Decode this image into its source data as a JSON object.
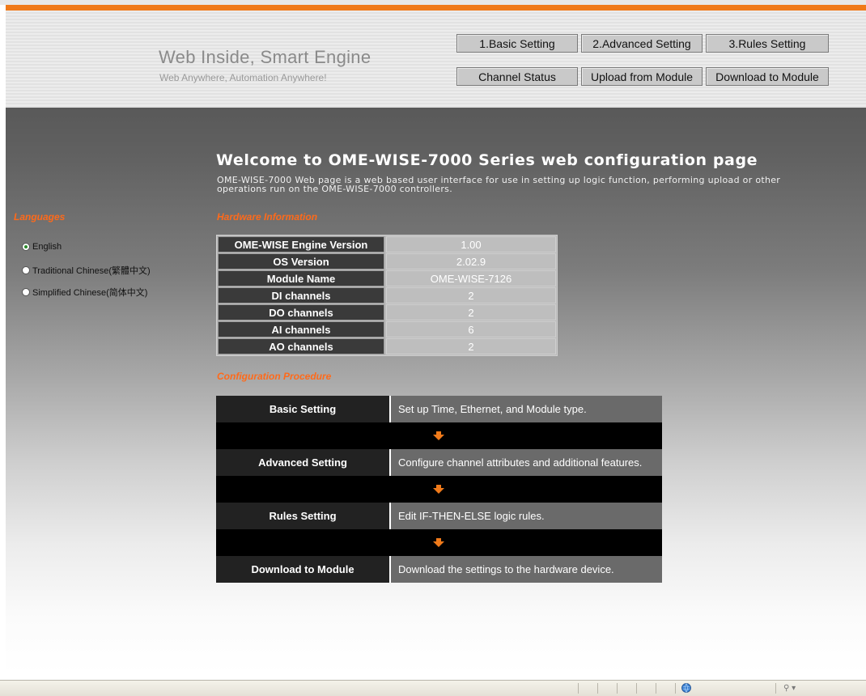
{
  "header": {
    "slogan_main": "Web Inside, Smart Engine",
    "slogan_sub": "Web Anywhere, Automation Anywhere!",
    "nav_buttons": [
      {
        "label": "1.Basic Setting"
      },
      {
        "label": "2.Advanced Setting"
      },
      {
        "label": "3.Rules Setting"
      },
      {
        "label": "Channel Status"
      },
      {
        "label": "Upload from Module"
      },
      {
        "label": "Download to Module"
      }
    ]
  },
  "welcome": {
    "title": "Welcome to OME-WISE-7000 Series web configuration page",
    "description": "OME-WISE-7000 Web page is a web based user interface for use in setting up logic function, performing upload or other operations run on the OME-WISE-7000 controllers."
  },
  "languages": {
    "heading": "Languages",
    "options": [
      {
        "label": "English",
        "selected": true
      },
      {
        "label": "Traditional Chinese(繁體中文)",
        "selected": false
      },
      {
        "label": "Simplified Chinese(简体中文)",
        "selected": false
      }
    ]
  },
  "hardware": {
    "heading": "Hardware Information",
    "rows": [
      {
        "label": "OME-WISE Engine Version",
        "value": "1.00"
      },
      {
        "label": "OS Version",
        "value": "2.02.9"
      },
      {
        "label": "Module Name",
        "value": "OME-WISE-7126"
      },
      {
        "label": "DI channels",
        "value": "2"
      },
      {
        "label": "DO channels",
        "value": "2"
      },
      {
        "label": "AI channels",
        "value": "6"
      },
      {
        "label": "AO channels",
        "value": "2"
      }
    ]
  },
  "procedure": {
    "heading": "Configuration Procedure",
    "steps": [
      {
        "name": "Basic Setting",
        "desc": "Set up Time, Ethernet, and Module type."
      },
      {
        "name": "Advanced Setting",
        "desc": "Configure channel attributes and additional features."
      },
      {
        "name": "Rules Setting",
        "desc": "Edit IF-THEN-ELSE logic rules."
      },
      {
        "name": "Download to Module",
        "desc": "Download the settings to the hardware device."
      }
    ]
  },
  "colors": {
    "accent": "#f07a1a",
    "section_heading": "#ff6a1a"
  },
  "statusbar": {
    "icons": [
      "internet-zone-icon",
      "zoom-icon"
    ]
  }
}
